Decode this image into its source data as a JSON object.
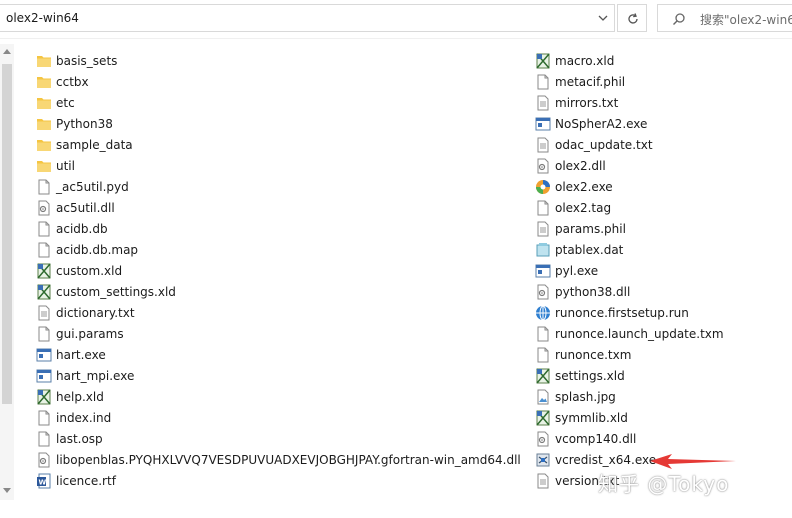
{
  "address_bar": {
    "path": "olex2-win64"
  },
  "search": {
    "placeholder": "搜索\"olex2-win64\""
  },
  "files_left": [
    {
      "name": "basis_sets",
      "icon": "folder-icon"
    },
    {
      "name": "cctbx",
      "icon": "folder-icon"
    },
    {
      "name": "etc",
      "icon": "folder-icon"
    },
    {
      "name": "Python38",
      "icon": "folder-icon"
    },
    {
      "name": "sample_data",
      "icon": "folder-icon"
    },
    {
      "name": "util",
      "icon": "folder-icon"
    },
    {
      "name": "_ac5util.pyd",
      "icon": "blank-file-icon"
    },
    {
      "name": "ac5util.dll",
      "icon": "dll-file-icon"
    },
    {
      "name": "acidb.db",
      "icon": "blank-file-icon"
    },
    {
      "name": "acidb.db.map",
      "icon": "blank-file-icon"
    },
    {
      "name": "custom.xld",
      "icon": "xld-file-icon"
    },
    {
      "name": "custom_settings.xld",
      "icon": "xld-file-icon"
    },
    {
      "name": "dictionary.txt",
      "icon": "text-file-icon"
    },
    {
      "name": "gui.params",
      "icon": "blank-file-icon"
    },
    {
      "name": "hart.exe",
      "icon": "exe-file-icon"
    },
    {
      "name": "hart_mpi.exe",
      "icon": "exe-file-icon"
    },
    {
      "name": "help.xld",
      "icon": "xld-file-icon"
    },
    {
      "name": "index.ind",
      "icon": "blank-file-icon"
    },
    {
      "name": "last.osp",
      "icon": "blank-file-icon"
    },
    {
      "name": "libopenblas.PYQHXLVVQ7VESDPUVUADXEVJOBGHJPAY.gfortran-win_amd64.dll",
      "icon": "dll-file-icon"
    },
    {
      "name": "licence.rtf",
      "icon": "word-doc-icon"
    }
  ],
  "files_right": [
    {
      "name": "macro.xld",
      "icon": "xld-file-icon"
    },
    {
      "name": "metacif.phil",
      "icon": "blank-file-icon"
    },
    {
      "name": "mirrors.txt",
      "icon": "text-file-icon"
    },
    {
      "name": "NoSpherA2.exe",
      "icon": "exe-file-icon"
    },
    {
      "name": "odac_update.txt",
      "icon": "text-file-icon"
    },
    {
      "name": "olex2.dll",
      "icon": "dll-file-icon"
    },
    {
      "name": "olex2.exe",
      "icon": "olex2-app-icon"
    },
    {
      "name": "olex2.tag",
      "icon": "blank-file-icon"
    },
    {
      "name": "params.phil",
      "icon": "text-file-icon"
    },
    {
      "name": "ptablex.dat",
      "icon": "dat-file-icon"
    },
    {
      "name": "pyl.exe",
      "icon": "exe-file-icon"
    },
    {
      "name": "python38.dll",
      "icon": "dll-file-icon"
    },
    {
      "name": "runonce.firstsetup.run",
      "icon": "globe-file-icon"
    },
    {
      "name": "runonce.launch_update.txm",
      "icon": "blank-file-icon"
    },
    {
      "name": "runonce.txm",
      "icon": "blank-file-icon"
    },
    {
      "name": "settings.xld",
      "icon": "xld-file-icon"
    },
    {
      "name": "splash.jpg",
      "icon": "image-file-icon"
    },
    {
      "name": "symmlib.xld",
      "icon": "xld-file-icon"
    },
    {
      "name": "vcomp140.dll",
      "icon": "dll-file-icon"
    },
    {
      "name": "vcredist_x64.exe",
      "icon": "installer-icon"
    },
    {
      "name": "version.txt",
      "icon": "text-file-icon"
    }
  ],
  "watermark": {
    "text": "知乎 @Tokyo"
  },
  "colors": {
    "folder": "#f5c542",
    "arrow": "#e53935",
    "accent": "#1f6fbf"
  }
}
